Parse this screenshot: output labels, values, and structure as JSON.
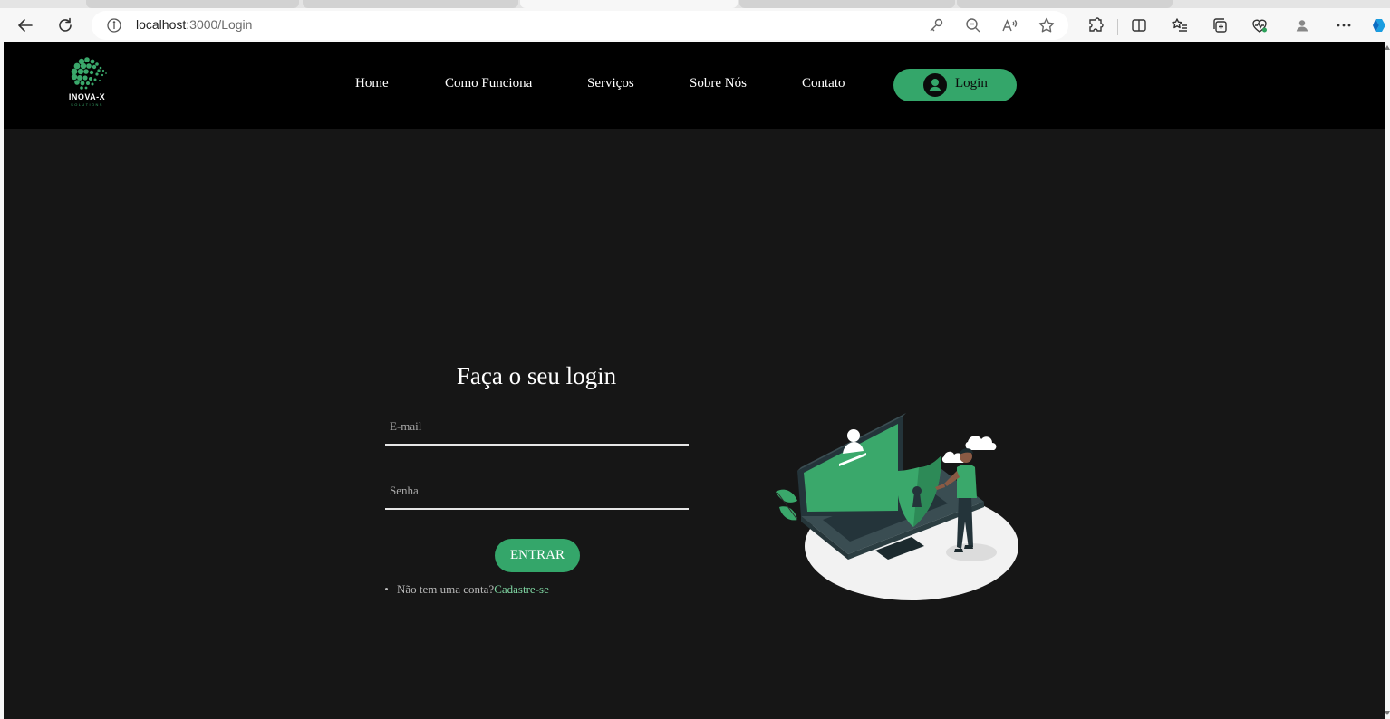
{
  "browser": {
    "url_host": "localhost",
    "url_path": ":3000/Login"
  },
  "nav": {
    "logo_name": "INOVA-X",
    "logo_sub": "SOLUTIONS",
    "links": [
      "Home",
      "Como Funciona",
      "Serviços",
      "Sobre Nós",
      "Contato"
    ],
    "login_label": "Login"
  },
  "form": {
    "title": "Faça o seu login",
    "email_placeholder": "E-mail",
    "senha_placeholder": "Senha",
    "submit_label": "ENTRAR",
    "no_account_text": "Não tem uma conta?",
    "signup_link": "Cadastre-se"
  },
  "colors": {
    "accent": "#34a66a",
    "page_bg": "#161616",
    "navbar_bg": "#000000"
  }
}
